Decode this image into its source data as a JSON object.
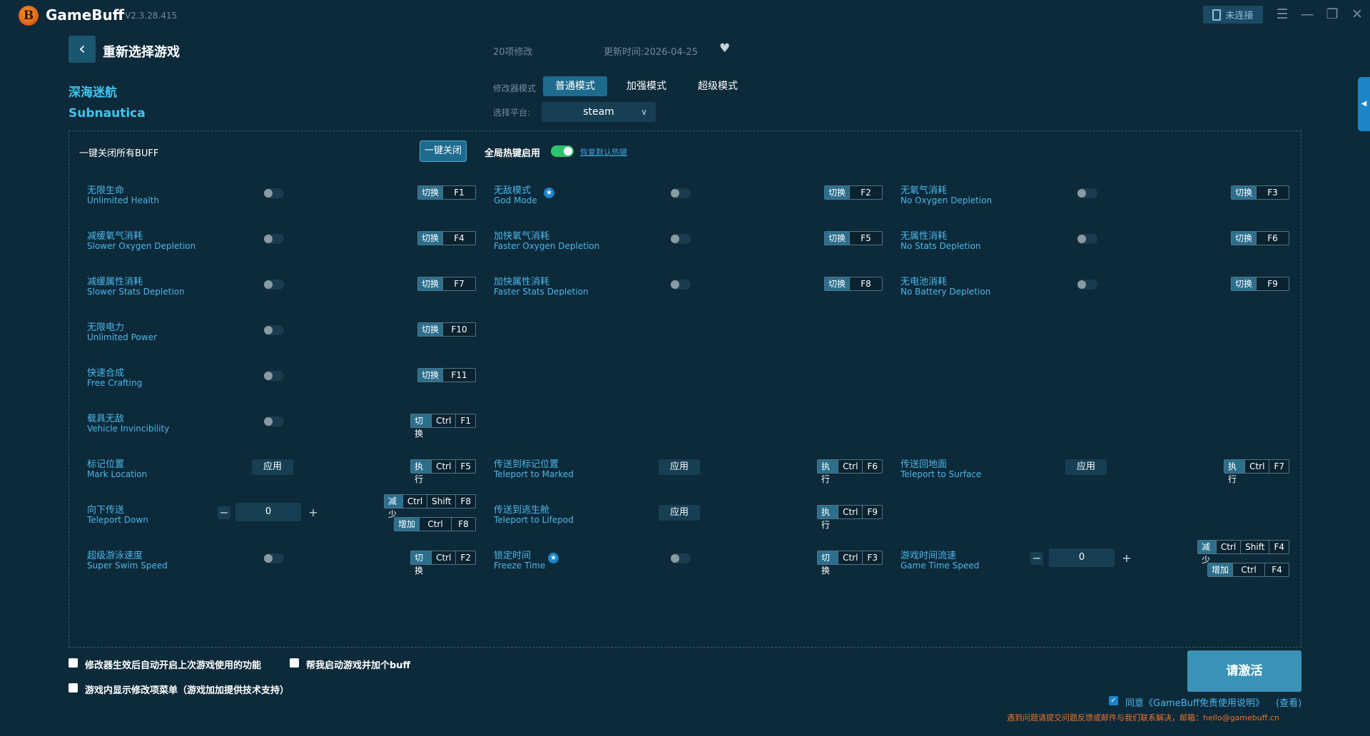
{
  "app": {
    "title": "GameBuff",
    "version": "V2.3.28.415",
    "connect_label": "未连接"
  },
  "header": {
    "page_title": "重新选择游戏",
    "game_cn": "深海迷航",
    "game_en": "Subnautica",
    "mod_count": "20项修改",
    "update_time": "更新时间:2026-04-25",
    "mode_label": "修改器模式",
    "modes": [
      "普通模式",
      "加强模式",
      "超级模式"
    ],
    "platform_label": "选择平台:",
    "platform_value": "steam"
  },
  "controls": {
    "close_all_label": "一键关闭所有BUFF",
    "close_all_button": "一键关闭",
    "global_hotkey_label": "全局热键启用",
    "restore_hotkey_link": "恢复默认热键"
  },
  "items": {
    "unlimited_health": {
      "cn": "无限生命",
      "en": "Unlimited Health",
      "action": "切换",
      "keys": [
        "F1"
      ]
    },
    "god_mode": {
      "cn": "无敌模式",
      "en": "God Mode",
      "action": "切换",
      "keys": [
        "F2"
      ]
    },
    "no_oxygen": {
      "cn": "无氧气消耗",
      "en": "No Oxygen Depletion",
      "action": "切换",
      "keys": [
        "F3"
      ]
    },
    "slower_oxygen": {
      "cn": "减缓氧气消耗",
      "en": "Slower Oxygen Depletion",
      "action": "切换",
      "keys": [
        "F4"
      ]
    },
    "faster_oxygen": {
      "cn": "加快氧气消耗",
      "en": "Faster Oxygen Depletion",
      "action": "切换",
      "keys": [
        "F5"
      ]
    },
    "no_stats": {
      "cn": "无属性消耗",
      "en": "No Stats Depletion",
      "action": "切换",
      "keys": [
        "F6"
      ]
    },
    "slower_stats": {
      "cn": "减缓属性消耗",
      "en": "Slower Stats Depletion",
      "action": "切换",
      "keys": [
        "F7"
      ]
    },
    "faster_stats": {
      "cn": "加快属性消耗",
      "en": "Faster Stats Depletion",
      "action": "切换",
      "keys": [
        "F8"
      ]
    },
    "no_battery": {
      "cn": "无电池消耗",
      "en": "No Battery Depletion",
      "action": "切换",
      "keys": [
        "F9"
      ]
    },
    "unlimited_power": {
      "cn": "无限电力",
      "en": "Unlimited Power",
      "action": "切换",
      "keys": [
        "F10"
      ]
    },
    "free_crafting": {
      "cn": "快速合成",
      "en": "Free Crafting",
      "action": "切换",
      "keys": [
        "F11"
      ]
    },
    "vehicle_invincibility": {
      "cn": "载具无敌",
      "en": "Vehicle Invincibility",
      "action": "切换",
      "keys": [
        "Ctrl",
        "F1"
      ]
    },
    "mark_location": {
      "cn": "标记位置",
      "en": "Mark Location",
      "apply": "应用",
      "action": "执行",
      "keys": [
        "Ctrl",
        "F5"
      ]
    },
    "teleport_marked": {
      "cn": "传送到标记位置",
      "en": "Teleport to Marked",
      "apply": "应用",
      "action": "执行",
      "keys": [
        "Ctrl",
        "F6"
      ]
    },
    "teleport_surface": {
      "cn": "传送回地面",
      "en": "Teleport to Surface",
      "apply": "应用",
      "action": "执行",
      "keys": [
        "Ctrl",
        "F7"
      ]
    },
    "teleport_down": {
      "cn": "向下传送",
      "en": "Teleport Down",
      "value": "0",
      "dec_action": "减少",
      "dec_keys": [
        "Ctrl",
        "Shift",
        "F8"
      ],
      "inc_action": "增加",
      "inc_keys": [
        "Ctrl",
        "F8"
      ]
    },
    "teleport_lifepod": {
      "cn": "传送到逃生舱",
      "en": "Teleport to Lifepod",
      "apply": "应用",
      "action": "执行",
      "keys": [
        "Ctrl",
        "F9"
      ]
    },
    "super_swim": {
      "cn": "超级游泳速度",
      "en": "Super Swim Speed",
      "action": "切换",
      "keys": [
        "Ctrl",
        "F2"
      ]
    },
    "freeze_time": {
      "cn": "锁定时间",
      "en": "Freeze Time",
      "action": "切换",
      "keys": [
        "Ctrl",
        "F3"
      ]
    },
    "game_time_speed": {
      "cn": "游戏时间流速",
      "en": "Game Time Speed",
      "value": "0",
      "dec_action": "减少",
      "dec_keys": [
        "Ctrl",
        "Shift",
        "F4"
      ],
      "inc_action": "增加",
      "inc_keys": [
        "Ctrl",
        "F4"
      ]
    }
  },
  "footer": {
    "auto_enable_label": "修改器生效后自动开启上次游戏使用的功能",
    "launch_game_label": "帮我启动游戏并加个buff",
    "ingame_menu_label": "游戏内显示修改项菜单（游戏加加提供技术支持）",
    "activate_button": "请激活",
    "agree_text": "同意《GameBuff免责使用说明》",
    "agree_view": "(查看)",
    "contact_text": "遇到问题请提交问题反馈或邮件与我们联系解决，邮箱：hello@gamebuff.cn"
  },
  "colors": {
    "background": "#0d2a3a",
    "accent": "#1a86c7",
    "label_blue": "#4cb6e8",
    "toggle_on": "#2cc36b",
    "warning": "#e8742b"
  }
}
